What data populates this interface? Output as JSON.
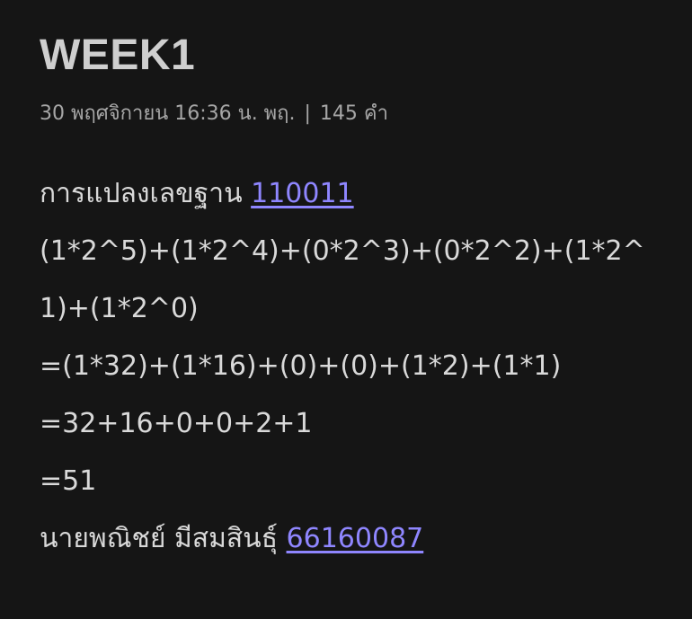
{
  "note": {
    "title": "WEEK1",
    "meta": {
      "datetime": "30 พฤศจิกายน 16:36 น. พฤ.",
      "separator": "|",
      "word_count": "145 คำ"
    },
    "lines": {
      "l1_text": "การแปลงเลขฐาน ",
      "l1_link": "110011",
      "l2": "(1*2^5)+(1*2^4)+(0*2^3)+(0*2^2)+(1*2^1)+(1*2^0)",
      "l3": "=(1*32)+(1*16)+(0)+(0)+(1*2)+(1*1)",
      "l4": "=32+16+0+0+2+1",
      "l5": "=51",
      "l6_text": "นายพณิชย์ มีสมสินธุ์ ",
      "l6_link": "66160087"
    }
  },
  "colors": {
    "background": "#151515",
    "text": "#d9d9d9",
    "muted": "#a6a6a6",
    "link": "#8f86ff"
  }
}
